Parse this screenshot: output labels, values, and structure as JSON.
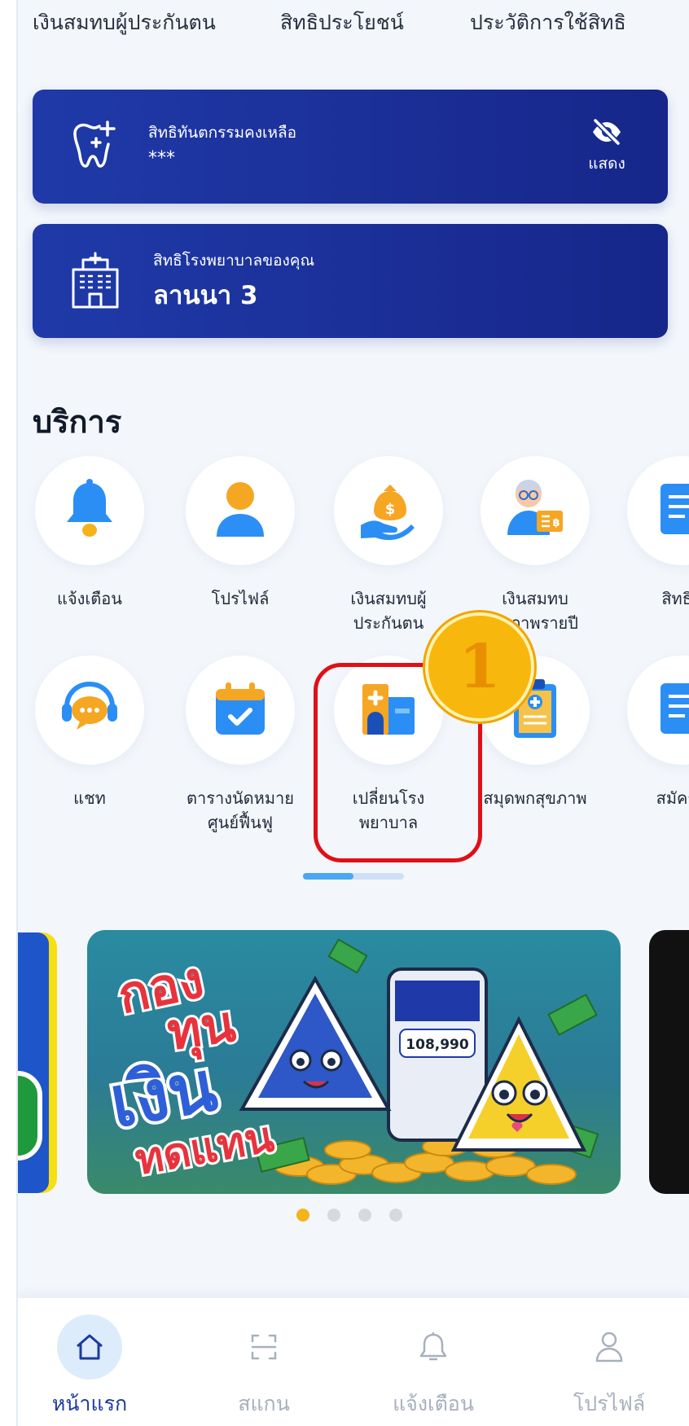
{
  "top_tabs": [
    "เงินสมทบผู้ประกันตน",
    "สิทธิประโยชน์",
    "ประวัติการใช้สิทธิ"
  ],
  "dental_card": {
    "label": "สิทธิทันตกรรมคงเหลือ",
    "value": "***",
    "toggle_label": "แสดง",
    "icon": "tooth-plus-icon",
    "toggle_icon": "eye-off-icon"
  },
  "hospital_card": {
    "label": "สิทธิโรงพยาบาลของคุณ",
    "value": "ลานนา 3",
    "icon": "hospital-building-icon"
  },
  "services": {
    "title": "บริการ",
    "row1": [
      {
        "label": "แจ้งเตือน",
        "icon": "bell-icon"
      },
      {
        "label": "โปรไฟล์",
        "icon": "user-icon"
      },
      {
        "label": "เงินสมทบผู้",
        "label2": "ประกันตน",
        "icon": "money-bag-hand-icon"
      },
      {
        "label": "เงินสมทบ",
        "label2": "ราภาพรายปี",
        "icon": "elderly-money-icon"
      },
      {
        "label": "สิทธิผู้",
        "icon": "document-icon"
      }
    ],
    "row2": [
      {
        "label": "แชท",
        "icon": "chat-support-icon"
      },
      {
        "label": "ตารางนัดหมาย",
        "label2": "ศูนย์ฟื้นฟู",
        "icon": "calendar-check-icon"
      },
      {
        "label": "เปลี่ยนโรง",
        "label2": "พยาบาล",
        "icon": "hospital-change-icon"
      },
      {
        "label": "สมุดพกสุขภาพ",
        "icon": "clipboard-health-icon"
      },
      {
        "label": "สมัครม",
        "icon": "document-icon"
      }
    ]
  },
  "step_badge": "1",
  "banner": {
    "title_line1": "กอง",
    "title_line2": "ทุน",
    "title_line3": "เงิน",
    "title_line4": "ทดแทน",
    "phone_amount": "108,990"
  },
  "carousel": {
    "pages": 4,
    "active": 1
  },
  "bottom_nav": [
    {
      "label": "หน้าแรก",
      "icon": "home-icon",
      "active": true
    },
    {
      "label": "สแกน",
      "icon": "scan-icon",
      "active": false
    },
    {
      "label": "แจ้งเตือน",
      "icon": "bell-outline-icon",
      "active": false
    },
    {
      "label": "โปรไฟล์",
      "icon": "user-outline-icon",
      "active": false
    }
  ],
  "colors": {
    "card_blue": "#1f3aa8",
    "highlight_red": "#e10f16",
    "badge_gold": "#f7b70c",
    "accent_blue": "#4ba6f3",
    "active_nav": "#1c3a9e"
  }
}
